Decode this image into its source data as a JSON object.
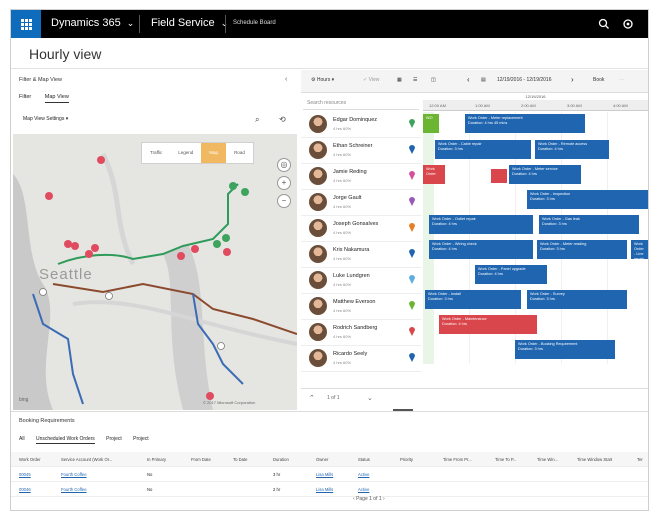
{
  "topnav": {
    "brand": "Dynamics 365",
    "app": "Field Service",
    "breadcrumb": "Schedule Board"
  },
  "page": {
    "title": "Hourly view"
  },
  "filter_panel": {
    "title": "Filter & Map View",
    "tabs": [
      "Filter",
      "Map View"
    ],
    "active_tab": "Map View",
    "map_settings": "Map View Settings",
    "map_toggles": [
      "Traffic",
      "Legend",
      "Map",
      "Road"
    ],
    "active_toggle": "Map",
    "map_label": "Seattle",
    "bing": "bing",
    "copyright": "© 2017 Microsoft Corporation"
  },
  "board": {
    "toolbar": {
      "hours": "Hours",
      "view": "View",
      "date_range": "12/19/2016 - 12/19/2016",
      "book": "Book"
    },
    "date": "12/19/2016",
    "times": [
      "12:00 AM",
      "1:00 AM",
      "2:00 AM",
      "3:00 AM",
      "4:00 AM"
    ],
    "search_placeholder": "Search resources",
    "resources": [
      {
        "name": "Edgar Dominquez",
        "meta": "4 hrs   60%"
      },
      {
        "name": "Ethan Schreiner",
        "meta": "4 hrs   60%"
      },
      {
        "name": "Jamie Reding",
        "meta": "4 hrs   60%"
      },
      {
        "name": "Jorge Gault",
        "meta": "4 hrs   60%"
      },
      {
        "name": "Joseph Gonsalves",
        "meta": "4 hrs   60%"
      },
      {
        "name": "Kris Nakamura",
        "meta": "4 hrs   60%"
      },
      {
        "name": "Luke Lundgren",
        "meta": "4 hrs   60%"
      },
      {
        "name": "Matthew Everson",
        "meta": "4 hrs   60%"
      },
      {
        "name": "Rodrich Sandberg",
        "meta": "4 hrs   60%"
      },
      {
        "name": "Ricardo Seely",
        "meta": "4 hrs   60%"
      }
    ],
    "jobs": [
      {
        "title": "Work Order - Meter replacement",
        "sub": "Duration: 4 hrs 45 mins"
      },
      {
        "title": "Work Order - Cable repair",
        "sub": "Duration: 3 hrs"
      },
      {
        "title": "Work Order - Remote access",
        "sub": "Duration: 4 hrs"
      },
      {
        "title": "Work Order - Meter service",
        "sub": "Duration: 4 hrs"
      },
      {
        "title": "Work Order - Inspection",
        "sub": "Duration: 3 hrs"
      },
      {
        "title": "Work Order - Outlet repair",
        "sub": "Duration: 4 hrs"
      },
      {
        "title": "Work Order - Gas leak",
        "sub": "Duration: 3 hrs"
      },
      {
        "title": "Work Order - Wiring check",
        "sub": "Duration: 4 hrs"
      },
      {
        "title": "Work Order - Meter reading",
        "sub": "Duration: 3 hrs"
      },
      {
        "title": "Work Order - Line repair",
        "sub": "Duration: 4 hrs"
      },
      {
        "title": "Work Order - Panel upgrade",
        "sub": "Duration: 4 hrs"
      },
      {
        "title": "Work Order - Install",
        "sub": "Duration: 3 hrs"
      },
      {
        "title": "Work Order - Survey",
        "sub": "Duration: 3 hrs"
      },
      {
        "title": "Work Order - Maintenance",
        "sub": "Duration: 4 hrs"
      },
      {
        "title": "Work Order - Repair",
        "sub": "Duration: 3 hrs"
      },
      {
        "title": "Work Order - Emergency",
        "sub": "Duration: 2 hrs"
      },
      {
        "title": "Work Order - Booking Requirement",
        "sub": "Duration: 3 hrs"
      },
      {
        "title": "WO",
        "sub": ""
      },
      {
        "title": "Work Order",
        "sub": ""
      }
    ],
    "pager": "1 of 1"
  },
  "requirements": {
    "title": "Booking Requirements",
    "tabs": [
      "All",
      "Unscheduled Work Orders",
      "Project",
      "Project"
    ],
    "active_tab": "Unscheduled Work Orders",
    "columns": [
      "Work Order",
      "Service Account (Work Or...",
      "In Primary",
      "From Date",
      "To Date",
      "Duration",
      "Owner",
      "Status",
      "Priority",
      "Time From Pr...",
      "Time To P...",
      "Time Win...",
      "Time Window Start",
      "Ter"
    ],
    "rows": [
      [
        "00045",
        "Fourth Coffee",
        "No",
        "",
        "",
        "3 hr",
        "Lisa Mills",
        "Active",
        "",
        "",
        "",
        "",
        "",
        ""
      ],
      [
        "00046",
        "Fourth Coffee",
        "No",
        "",
        "",
        "2 hr",
        "Lisa Mills",
        "Active",
        "",
        "",
        "",
        "",
        "",
        ""
      ]
    ],
    "pager": "Page 1 of 1"
  }
}
